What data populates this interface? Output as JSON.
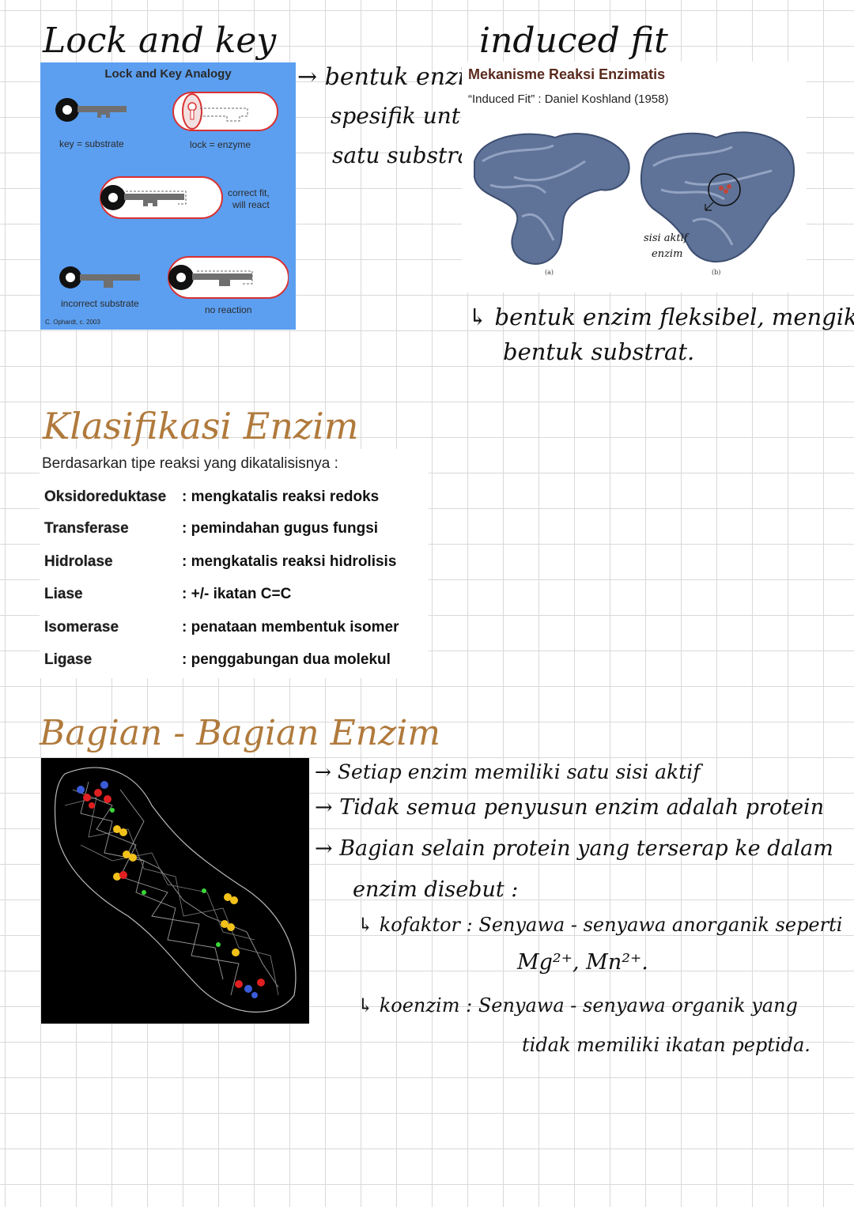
{
  "section1": {
    "lock_key_title": "Lock and key",
    "induced_fit_title": "induced fit",
    "lock_key_figure": {
      "title": "Lock and Key Analogy",
      "key_label": "key = substrate",
      "lock_label": "lock = enzyme",
      "correct_line1": "correct fit,",
      "correct_line2": "will react",
      "incorrect_label": "incorrect substrate",
      "no_reaction_label": "no reaction",
      "credit": "C. Ophardt, c. 2003"
    },
    "lock_key_note": [
      "→ bentuk enzim",
      "spesifik untuk",
      "satu substrat."
    ],
    "induced_fit_figure": {
      "title": "Mekanisme Reaksi Enzimatis",
      "subtitle": "“Induced Fit” :  Daniel Koshland (1958)",
      "panel_a": "(a)",
      "panel_b": "(b)",
      "annotation_line1": "sisi aktif",
      "annotation_line2": "enzim"
    },
    "induced_fit_note": [
      "↳ bentuk enzim fleksibel, mengikuti",
      "bentuk substrat."
    ]
  },
  "section2": {
    "heading": "Klasifikasi Enzim",
    "intro": "Berdasarkan tipe reaksi yang dikatalisisnya :",
    "rows": [
      {
        "name": "Oksidoreduktase",
        "desc": ": mengkatalis reaksi redoks"
      },
      {
        "name": "Transferase",
        "desc": ": pemindahan gugus fungsi"
      },
      {
        "name": "Hidrolase",
        "desc": ": mengkatalis reaksi hidrolisis"
      },
      {
        "name": "Liase",
        "desc": ": +/-  ikatan C=C"
      },
      {
        "name": "Isomerase",
        "desc": ": penataan membentuk isomer"
      },
      {
        "name": "Ligase",
        "desc": ": penggabungan dua molekul"
      }
    ]
  },
  "section3": {
    "heading": "Bagian - Bagian Enzim",
    "notes": [
      "→ Setiap enzim memiliki satu sisi aktif",
      "→ Tidak semua penyusun enzim adalah protein",
      "→ Bagian selain protein yang terserap ke dalam",
      "enzim disebut :",
      "↳ kofaktor : Senyawa - senyawa anorganik seperti",
      "Mg²⁺, Mn²⁺.",
      "↳ koenzim : Senyawa - senyawa organik yang",
      "tidak memiliki ikatan peptida."
    ]
  },
  "colors": {
    "heading": "#b07a3c",
    "lock_key_bg": "#5c9ff0",
    "figure_text_brown": "#5a2a1e"
  }
}
